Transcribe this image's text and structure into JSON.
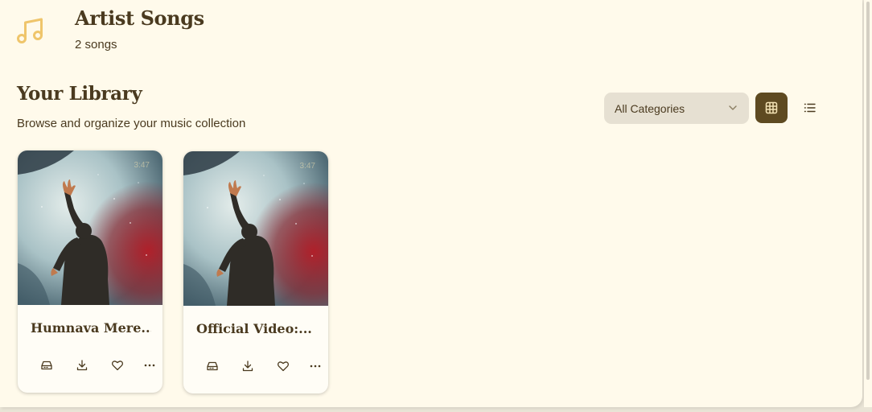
{
  "header": {
    "title": "Artist Songs",
    "count": "2 songs",
    "icon": "music-note-icon"
  },
  "library": {
    "title": "Your Library",
    "subtitle": "Browse and organize your music collection"
  },
  "controls": {
    "category_selected": "All Categories",
    "view_mode": "grid",
    "icons": [
      "chevron-down-icon",
      "grid-view-icon",
      "list-view-icon"
    ]
  },
  "songs": [
    {
      "title": "Humnava Mere...",
      "duration": "3:47"
    },
    {
      "title": "Official Video:...",
      "duration": "3:47"
    }
  ],
  "card_action_icons": [
    "queue-icon",
    "download-icon",
    "heart-icon",
    "more-icon"
  ],
  "colors": {
    "background": "#fffaeb",
    "accent": "#5e4a21",
    "text": "#4a3a1f",
    "icon_gold": "#efc56b",
    "select_bg": "#e6e0d2"
  }
}
